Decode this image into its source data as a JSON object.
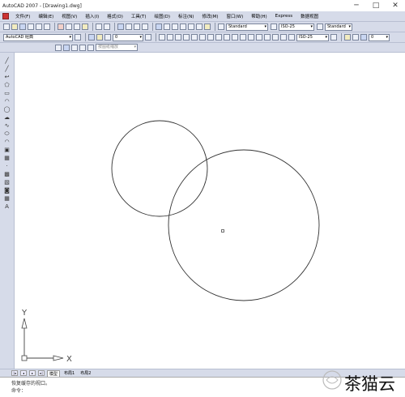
{
  "window": {
    "title": "AutoCAD 2007 - [Drawing1.dwg]",
    "controls": [
      "─",
      "□",
      "✕"
    ]
  },
  "menu": {
    "items": [
      "文件(F)",
      "编辑(E)",
      "视图(V)",
      "插入(I)",
      "格式(O)",
      "工具(T)",
      "绘图(D)",
      "标注(N)",
      "修改(M)",
      "窗口(W)",
      "帮助(H)",
      "Express",
      "数据视图"
    ]
  },
  "toolbar2": {
    "workspace": "AutoCAD 经典",
    "text_style": "Standard",
    "dim_style": "ISO-25",
    "table_style": "Standard",
    "dim_style_right": "ISO-25"
  },
  "toolbar3": {
    "layer": "0",
    "layer_right": "0"
  },
  "toolbar4": {
    "viewport_combo": "按图纸缩放"
  },
  "left_tools": {
    "icons": [
      "line-icon",
      "construction-line-icon",
      "polyline-icon",
      "polygon-icon",
      "rectangle-icon",
      "arc-icon",
      "circle-icon",
      "revision-cloud-icon",
      "spline-icon",
      "ellipse-icon",
      "ellipse-arc-icon",
      "insert-block-icon",
      "make-block-icon",
      "point-icon",
      "hatch-icon",
      "gradient-icon",
      "region-icon",
      "table-icon",
      "mtext-icon"
    ],
    "glyphs": [
      "╱",
      "╱",
      "↩",
      "⬠",
      "▭",
      "◠",
      "◯",
      "☁",
      "∿",
      "⬭",
      "◠",
      "▣",
      "▦",
      "·",
      "▩",
      "▧",
      "◙",
      "▦",
      "A"
    ]
  },
  "ucs": {
    "x_label": "X",
    "y_label": "Y"
  },
  "layout_tabs": {
    "nav": [
      "|◂",
      "◂",
      "▸",
      "▸|"
    ],
    "tabs": [
      "模型",
      "布局1",
      "布局2"
    ],
    "active": "模型"
  },
  "command": {
    "line1": "恢复缓存的视口。",
    "line2": "命令："
  },
  "watermark": {
    "text": "茶猫云"
  }
}
